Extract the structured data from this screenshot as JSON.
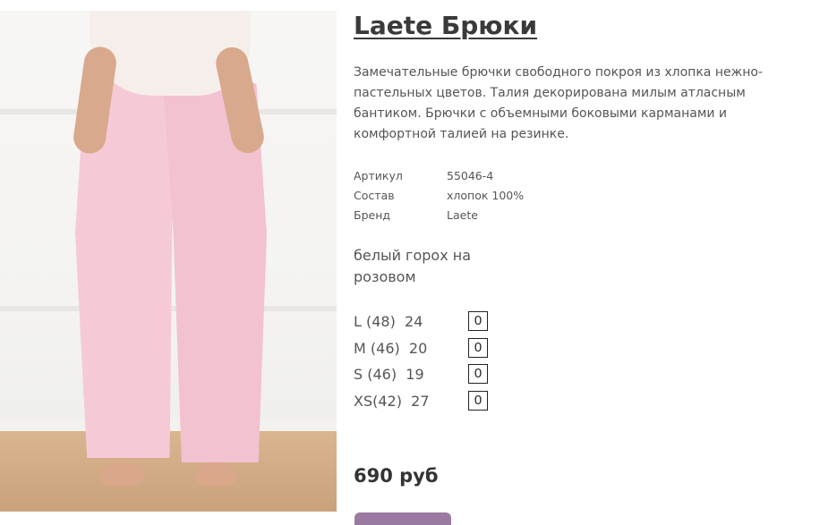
{
  "product": {
    "title": "Laete Брюки",
    "description": "Замечательные брючки свободного покроя из хлопка нежно-пастельных цветов. Талия декорирована милым атласным бантиком. Брючки с объемными боковыми карманами и комфортной талией на резинке.",
    "attributes": [
      {
        "key": "Артикул",
        "value": "55046-4"
      },
      {
        "key": "Состав",
        "value": "хлопок 100%"
      },
      {
        "key": "Бренд",
        "value": "Laete"
      }
    ],
    "color_name": "белый горох на розовом",
    "sizes": [
      {
        "label": "L (48)  24",
        "qty": "0"
      },
      {
        "label": "M (46)  20",
        "qty": "0"
      },
      {
        "label": "S (46)  19",
        "qty": "0"
      },
      {
        "label": "XS(42)  27",
        "qty": "0"
      }
    ],
    "price": "690 руб"
  },
  "colors": {
    "pants_pink": "#f5c9d6",
    "button": "#9a7aa0"
  }
}
